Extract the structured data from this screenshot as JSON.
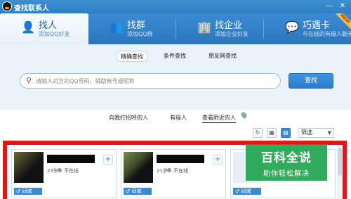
{
  "window": {
    "title": "查找联系人",
    "minimize": "—",
    "close": "✕"
  },
  "tabs": [
    {
      "label": "找人",
      "sub": "添加QQ好友",
      "icon": "person-icon",
      "glyph": "👤"
    },
    {
      "label": "找群",
      "sub": "添加QQ群",
      "icon": "group-icon",
      "glyph": "👥"
    },
    {
      "label": "找企业",
      "sub": "添加企业好友",
      "icon": "building-icon",
      "glyph": "🏢"
    },
    {
      "label": "巧遇卡",
      "sub": "与在线的有缘人聊天",
      "icon": "card-icon",
      "glyph": "💬",
      "badge": "NEW"
    }
  ],
  "search": {
    "modes": [
      "精确查找",
      "条件查找",
      "朋友网查找"
    ],
    "active_mode": "精确查找",
    "placeholder": "请输入对方的QQ号码、辅助帐号或昵称",
    "button": "查找"
  },
  "subnav": {
    "items": [
      "向我打招呼的人",
      "有缘人",
      "查看附近的人"
    ],
    "active": "查看附近的人"
  },
  "toolbar": {
    "refresh": "↻",
    "grid": "▦",
    "list": "▤",
    "filter_label": "筛选",
    "filter_arrow": "▼"
  },
  "results": [
    {
      "age": "23岁",
      "status": "不在线",
      "tag": "♂ 同城"
    },
    {
      "age": "21岁",
      "status": "不在线",
      "tag": "♂ 同城"
    },
    {
      "age": "",
      "status": "",
      "tag": "♂ 同城"
    }
  ],
  "watermark": {
    "line1": "百科全说",
    "line2": "助你轻松解决"
  },
  "colors": {
    "accent": "#2f7fc6",
    "highlight_border": "#f01010",
    "watermark": "#14a046"
  }
}
